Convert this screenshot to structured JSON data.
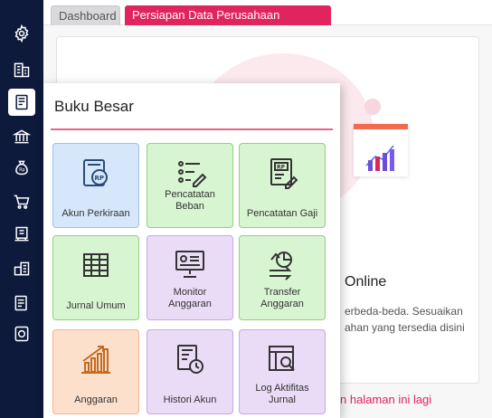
{
  "tabs": [
    {
      "label": "Dashboard",
      "active": false
    },
    {
      "label": "Persiapan Data Perusahaan",
      "active": true
    }
  ],
  "sidebar": {
    "icons": [
      "gear-icon",
      "building-icon",
      "ledger-icon",
      "bank-icon",
      "money-bag-icon",
      "cart-icon",
      "purchase-icon",
      "inventory-icon",
      "tax-icon",
      "asset-icon"
    ],
    "active_index": 2
  },
  "background": {
    "heading": "Online",
    "desc_line1": "erbeda-beda. Sesuaikan",
    "desc_line2": "ahan yang tersedia disini",
    "bottom_link": "n halaman ini lagi"
  },
  "popup": {
    "title": "Buku Besar",
    "tiles": [
      {
        "label": "Akun Perkiraan",
        "icon": "calculator-rp-icon",
        "color": "blue"
      },
      {
        "label": "Pencatatan Beban",
        "icon": "checklist-icon",
        "color": "green"
      },
      {
        "label": "Pencatatan Gaji",
        "icon": "payroll-icon",
        "color": "green"
      },
      {
        "label": "Jurnal Umum",
        "icon": "table-grid-icon",
        "color": "green"
      },
      {
        "label": "Monitor Anggaran",
        "icon": "monitor-icon",
        "color": "purple"
      },
      {
        "label": "Transfer Anggaran",
        "icon": "transfer-icon",
        "color": "green"
      },
      {
        "label": "Anggaran",
        "icon": "growth-chart-icon",
        "color": "orange"
      },
      {
        "label": "Histori Akun",
        "icon": "history-icon",
        "color": "purple"
      },
      {
        "label": "Log Aktifitas Jurnal",
        "icon": "log-search-icon",
        "color": "purple"
      }
    ]
  },
  "colors": {
    "sidebar": "#0d1a3c",
    "accent": "#e0245e",
    "tile_blue": "#d6e7fb",
    "tile_green": "#d8f5d2",
    "tile_purple": "#eadcf7",
    "tile_orange": "#fde0cc"
  }
}
